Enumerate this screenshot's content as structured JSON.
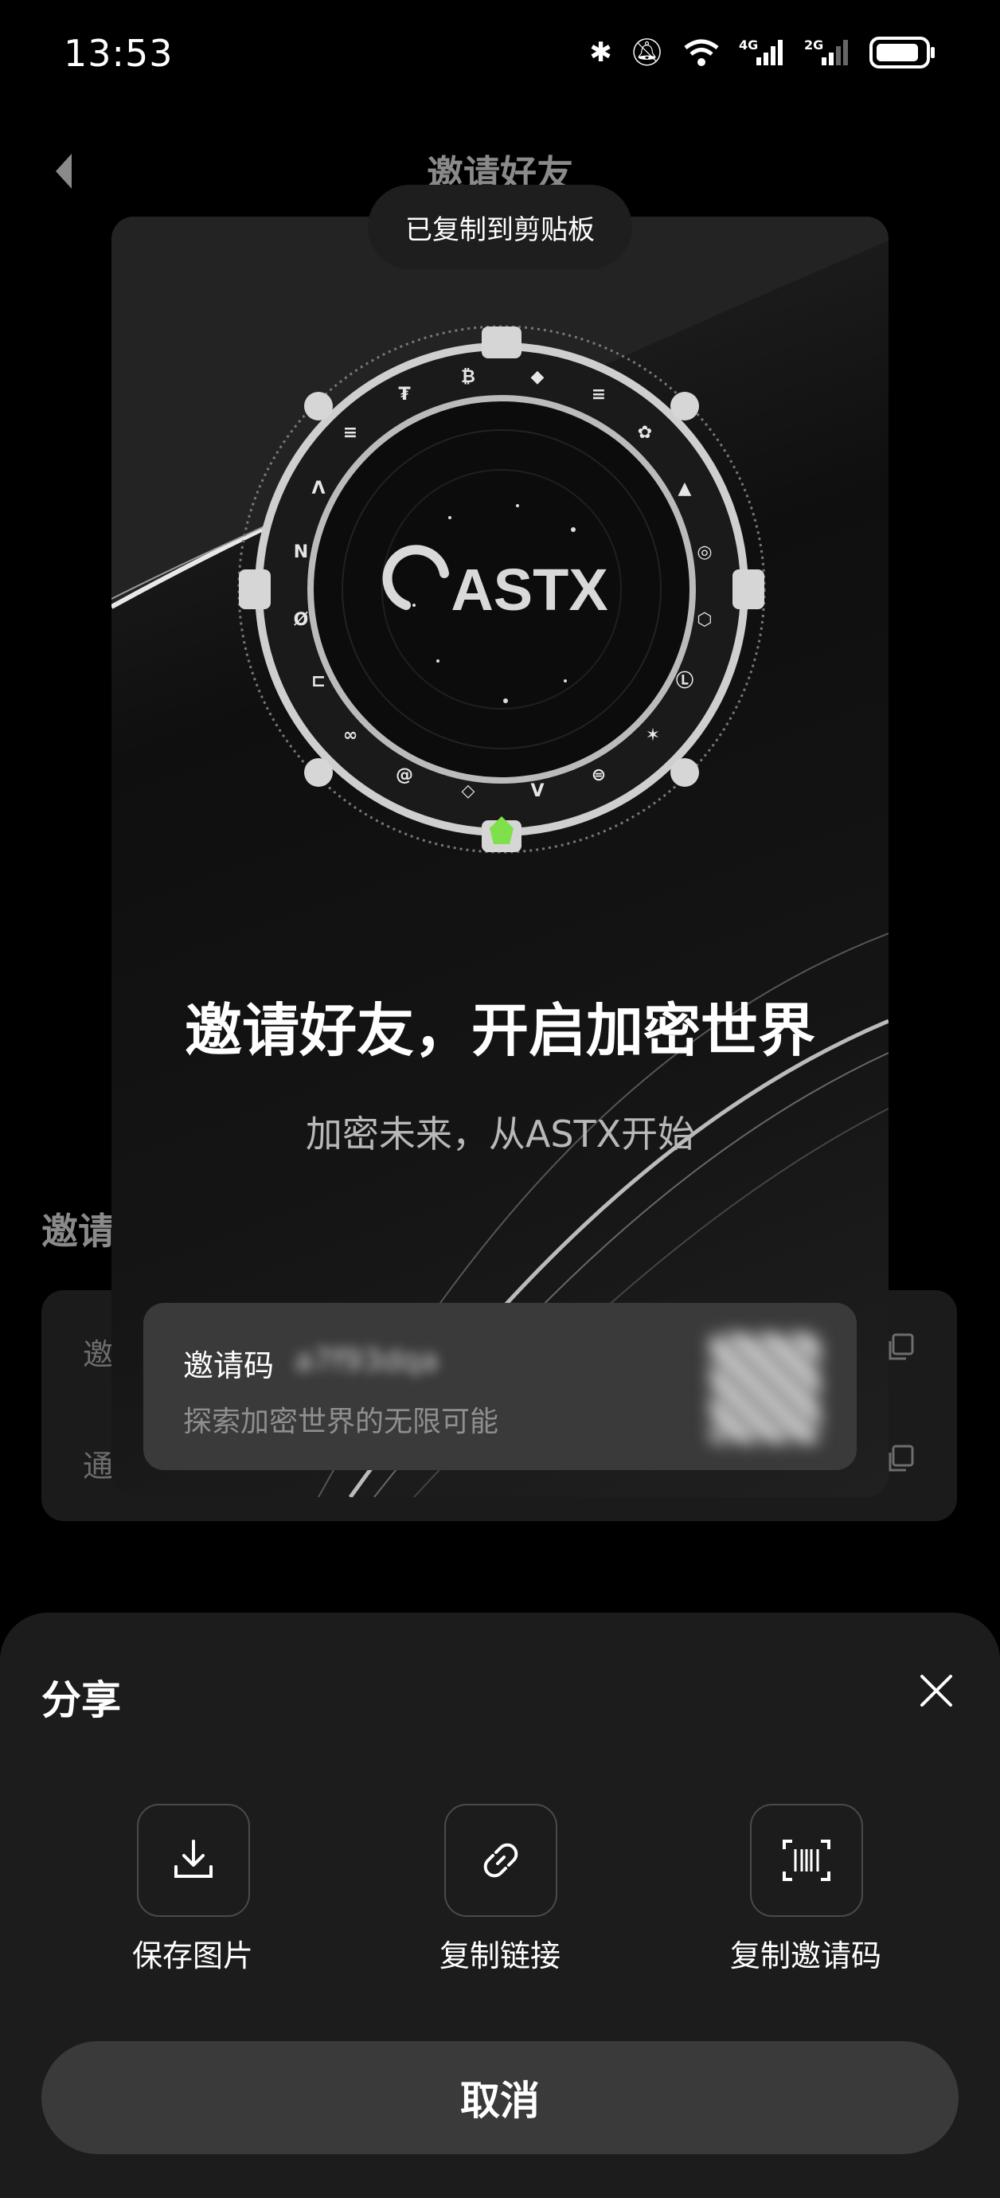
{
  "status_bar": {
    "time": "13:53",
    "icons": [
      "bluetooth-icon",
      "mute-icon",
      "wifi-icon",
      "signal-4g-icon",
      "signal-2g-icon",
      "battery-icon"
    ]
  },
  "page": {
    "title": "邀请好友",
    "section_title": "邀请",
    "rows": [
      "邀",
      "通"
    ]
  },
  "toast": "已复制到剪贴板",
  "card": {
    "brand": "ASTX",
    "headline": "邀请好友，开启加密世界",
    "subtitle": "加密未来，从ASTX开始",
    "invite_label": "邀请码",
    "invite_code": "a7f93dqa",
    "invite_desc": "探索加密世界的无限可能"
  },
  "share_sheet": {
    "title": "分享",
    "options": [
      {
        "label": "保存图片",
        "icon": "download-icon"
      },
      {
        "label": "复制链接",
        "icon": "link-icon"
      },
      {
        "label": "复制邀请码",
        "icon": "scan-code-icon"
      }
    ],
    "cancel": "取消"
  },
  "colors": {
    "background": "#000000",
    "sheet": "#1c1c1c",
    "button": "#3a3a3a",
    "accent_green": "#7ee04a"
  }
}
